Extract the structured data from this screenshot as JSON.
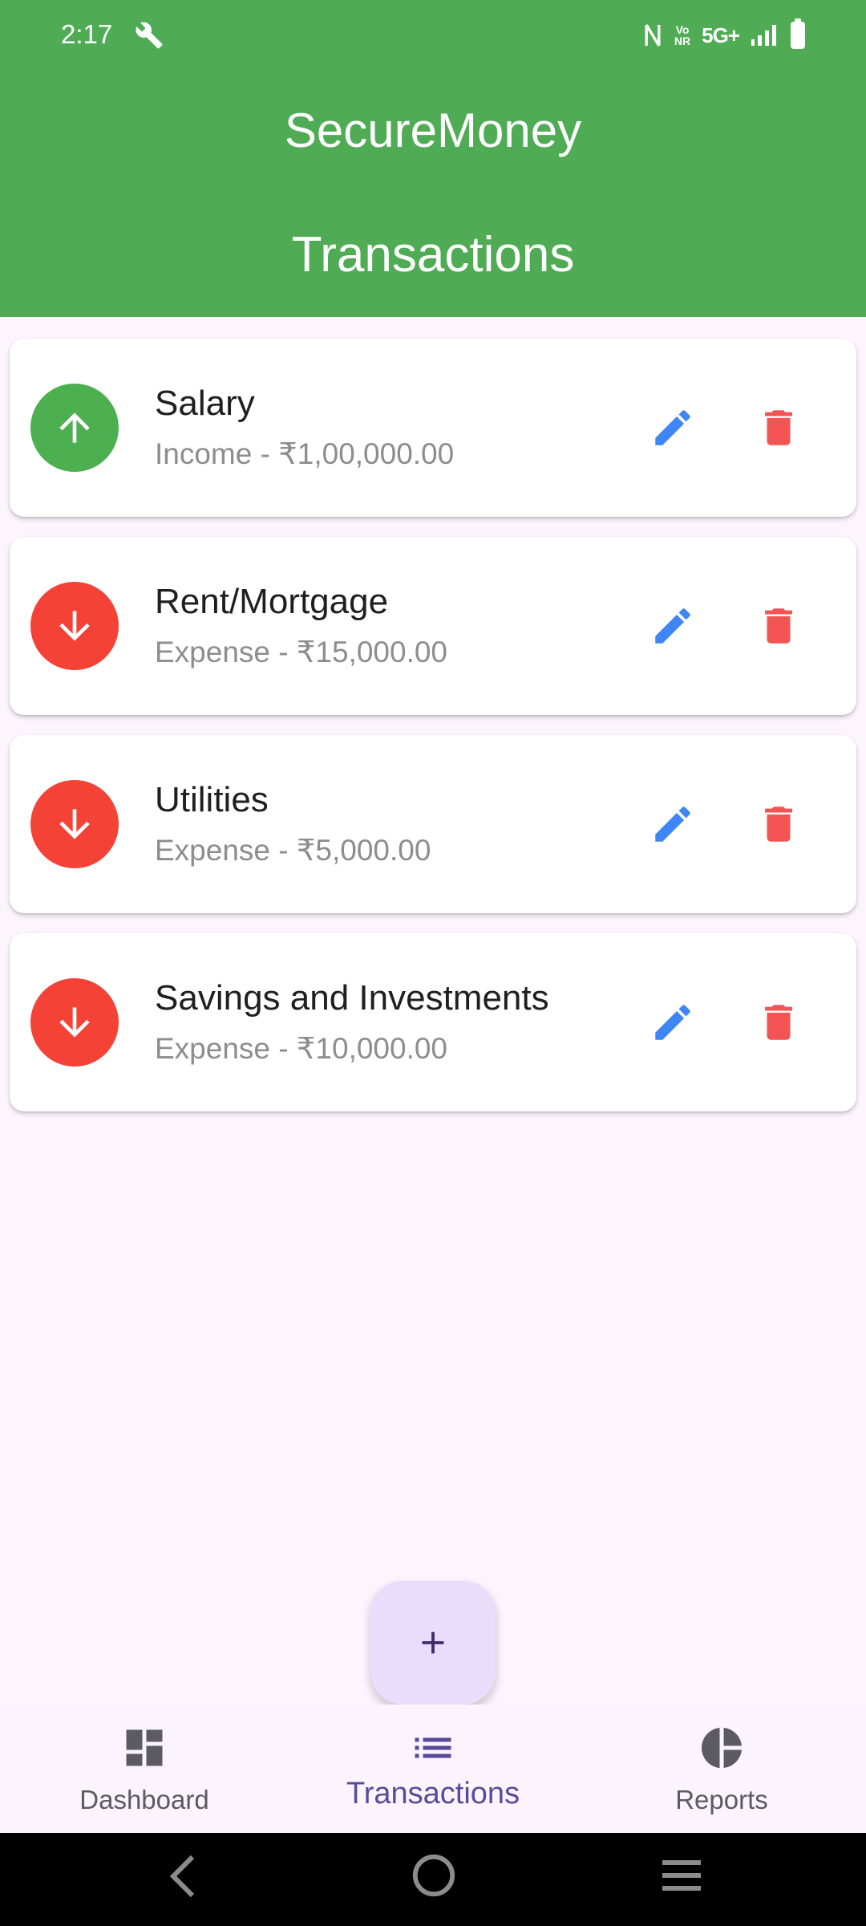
{
  "status_bar": {
    "time": "2:17",
    "network_vonr_top": "Vo",
    "network_vonr_bottom": "NR",
    "network": "5G+"
  },
  "header": {
    "app_title": "SecureMoney",
    "page_title": "Transactions",
    "background_color": "#4fac54"
  },
  "transactions": [
    {
      "title": "Salary",
      "subtitle": "Income - ₹1,00,000.00",
      "type": "income",
      "icon": "arrow-up-icon",
      "icon_color": "#4caf50"
    },
    {
      "title": "Rent/Mortgage",
      "subtitle": "Expense - ₹15,000.00",
      "type": "expense",
      "icon": "arrow-down-icon",
      "icon_color": "#f44336"
    },
    {
      "title": "Utilities",
      "subtitle": "Expense - ₹5,000.00",
      "type": "expense",
      "icon": "arrow-down-icon",
      "icon_color": "#f44336"
    },
    {
      "title": "Savings and Investments",
      "subtitle": "Expense - ₹10,000.00",
      "type": "expense",
      "icon": "arrow-down-icon",
      "icon_color": "#f44336"
    }
  ],
  "colors": {
    "edit": "#3f86f5",
    "delete": "#f25454",
    "fab_background": "#e9ddfc",
    "accent": "#5a4a9c"
  },
  "fab": {
    "icon": "plus-icon"
  },
  "bottom_nav": {
    "items": [
      {
        "label": "Dashboard",
        "icon": "dashboard-icon"
      },
      {
        "label": "Transactions",
        "icon": "list-icon",
        "selected": true
      },
      {
        "label": "Reports",
        "icon": "pie-chart-icon"
      }
    ]
  }
}
